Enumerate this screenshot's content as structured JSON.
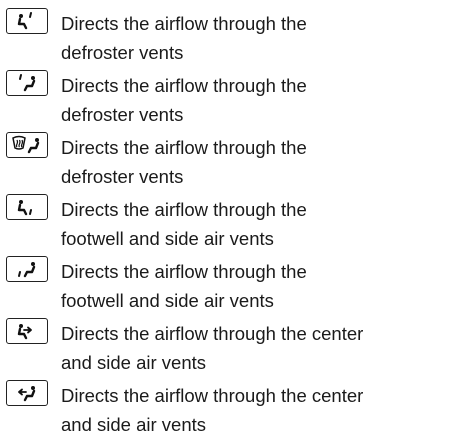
{
  "items": [
    {
      "icon": "defrost-windshield-left-icon",
      "line1": "Directs the airflow through the",
      "line2": "defroster vents"
    },
    {
      "icon": "defrost-windshield-right-icon",
      "line1": "Directs the airflow through the",
      "line2": "defroster vents"
    },
    {
      "icon": "defrost-windshield-heat-icon",
      "line1": "Directs the airflow through the",
      "line2": "defroster vents"
    },
    {
      "icon": "footwell-left-icon",
      "line1": "Directs the airflow through the",
      "line2": "footwell and side air vents"
    },
    {
      "icon": "footwell-right-icon",
      "line1": "Directs the airflow through the",
      "line2": "footwell and side air vents"
    },
    {
      "icon": "center-vents-left-icon",
      "line1": "Directs the airflow through the center",
      "line2": "and side air vents"
    },
    {
      "icon": "center-vents-right-icon",
      "line1": "Directs the airflow through the center",
      "line2": "and side air vents"
    }
  ]
}
